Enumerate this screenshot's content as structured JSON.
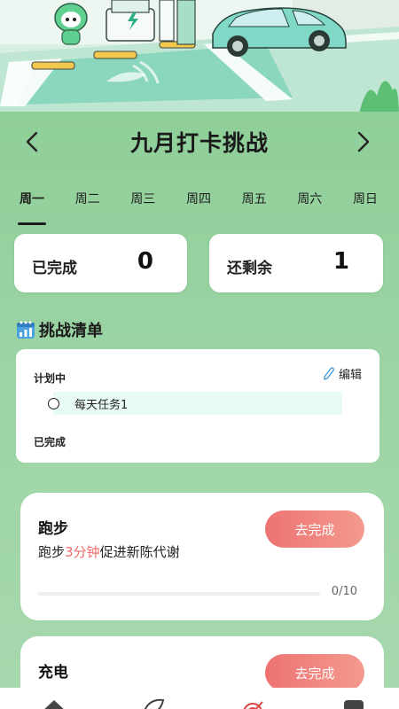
{
  "hero": {
    "charger_icon": "lightning-icon",
    "mascot": "green-mascot-character",
    "car": "electric-car",
    "colors": {
      "sky": "#e9f5ee",
      "lot": "#7fd0b0",
      "car": "#7fd9c6"
    }
  },
  "header": {
    "title": "九月打卡挑战",
    "prev_icon": "chevron-left-icon",
    "next_icon": "chevron-right-icon"
  },
  "week": {
    "tabs": [
      "周一",
      "周二",
      "周三",
      "周四",
      "周五",
      "周六",
      "周日"
    ],
    "active_index": 0
  },
  "stats": {
    "completed_label": "已完成",
    "completed_value": "0",
    "remaining_label": "还剩余",
    "remaining_value": "1"
  },
  "checklist": {
    "title": "挑战清单",
    "icon": "chart-calendar-icon",
    "planned_label": "计划中",
    "edit_label": "编辑",
    "edit_icon": "pen-icon",
    "tasks": [
      "每天任务1"
    ],
    "done_label": "已完成"
  },
  "challenges": [
    {
      "title": "跑步",
      "desc_prefix": "跑步",
      "desc_highlight": "3分钟",
      "desc_suffix": "促进新陈代谢",
      "button": "去完成",
      "progress_text": "0/10",
      "progress": 0
    },
    {
      "title": "充电",
      "button": "去完成"
    }
  ],
  "colors": {
    "panel": "#9ad3a3",
    "accent": "#ee7373",
    "highlight": "#ee6b6b"
  },
  "bottom_nav": {
    "icons": [
      "home-icon",
      "leaf-icon",
      "target-icon",
      "profile-icon"
    ]
  }
}
